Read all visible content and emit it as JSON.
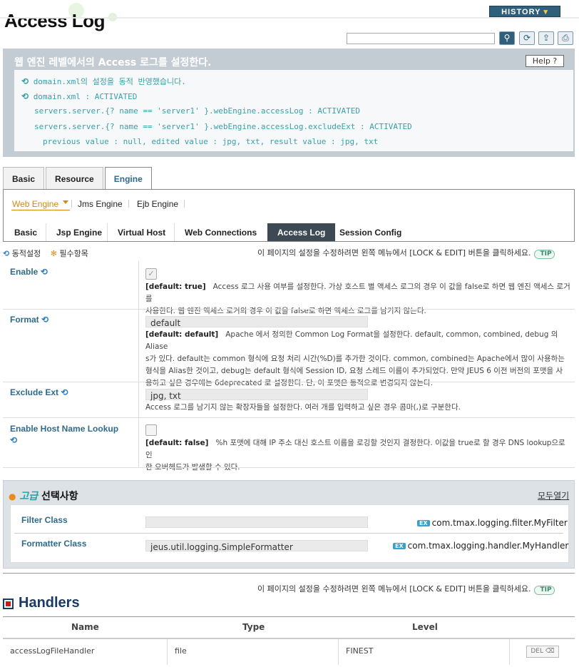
{
  "header": {
    "title": "Access Log",
    "history_label": "HISTORY",
    "search_value": ""
  },
  "message": {
    "title": "웹 엔진 레벨에서의 Access 로그를 설정한다.",
    "help_label": "Help",
    "lines": [
      "domain.xml의 설정을 동적 반영했습니다.",
      "domain.xml : ACTIVATED",
      "servers.server.{? name == 'server1' }.webEngine.accessLog : ACTIVATED",
      "servers.server.{? name == 'server1' }.webEngine.accessLog.excludeExt : ACTIVATED",
      "previous value : null, edited value : jpg, txt, result value : jpg, txt"
    ]
  },
  "tabs": [
    "Basic",
    "Resource",
    "Engine"
  ],
  "engine_tabs": [
    "Web Engine",
    "Jms Engine",
    "Ejb Engine"
  ],
  "web_tabs": [
    "Basic",
    "Jsp Engine",
    "Virtual Host",
    "Web Connections",
    "Access Log",
    "Session Config"
  ],
  "legend": {
    "dynamic": "동적설정",
    "required": "필수항목"
  },
  "notice": "이 페이지의 설정을 수정하려면 왼쪽 메뉴에서 [LOCK & EDIT] 버튼을 클릭하세요.",
  "tip_label": "TIP",
  "properties": {
    "enable": {
      "label": "Enable",
      "default": "[default: true]",
      "desc1": "Access 로그 사용 여부를 설정한다. 가상 호스트 별 액세스 로그의 경우 이 값을 false로 하면 웹 엔진 액세스 로거를",
      "desc2": "사용한다. 웹 엔진 액세스 로거의 경우 이 값을 false로 하면 액세스 로그를 남기지 않는다."
    },
    "format": {
      "label": "Format",
      "value": "default",
      "default": "[default: default]",
      "desc1": "Apache 에서 정의한 Common Log Format을 설정한다. default, common, combined, debug 의 Aliase",
      "desc2": "s가 있다. default는 common 형식에 요청 처리 시간(%D)를 추가한 것이다. common, combined는 Apache에서 많이 사용하는",
      "desc3": "형식을 Alias한 것이고, debug는 default 형식에 Session ID, 요청 스레드 이름이 추가되었다. 만약 JEUS 6 이전 버전의 포맷을 사",
      "desc4": "용하고 싶은 경우에는 6deprecated 로 설정한다. 단, 이 포맷은 동적으로 변경되지 않는다."
    },
    "exclude_ext": {
      "label": "Exclude Ext",
      "value": "jpg, txt",
      "desc1": "Access 로그를 남기지 않는 확장자들을 설정한다. 여러 개를 입력하고 싶은 경우 콤마(,)로 구분한다."
    },
    "host_lookup": {
      "label": "Enable Host Name Lookup",
      "default": "[default: false]",
      "desc1": "%h 포맷에 대해 IP 주소 대신 호스트 이름을 로깅할 것인지 결정한다. 이값을 true로 할 경우 DNS lookup으로 인",
      "desc2": "한 오버헤드가 발생할 수 있다."
    }
  },
  "advanced": {
    "title_hl": "고급",
    "title": "선택사항",
    "expand_all": "모두열기",
    "ex_label": "EX",
    "filter_label": "Filter Class",
    "filter_value": "",
    "filter_example": "com.tmax.logging.filter.MyFilter",
    "formatter_label": "Formatter Class",
    "formatter_value": "jeus.util.logging.SimpleFormatter",
    "formatter_example": "com.tmax.logging.handler.MyHandler"
  },
  "handlers": {
    "title": "Handlers",
    "columns": [
      "Name",
      "Type",
      "Level"
    ],
    "rows": [
      {
        "name": "accessLogFileHandler",
        "type": "file",
        "level": "FINEST",
        "del": "DEL"
      }
    ]
  }
}
